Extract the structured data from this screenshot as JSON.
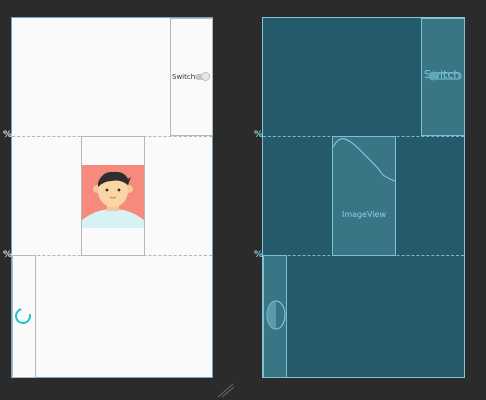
{
  "design": {
    "switch_label": "Switch",
    "image_icon": "avatar-portrait-icon",
    "progress_icon": "progress-spinner-icon"
  },
  "blueprint": {
    "switch_label": "Switch",
    "imageview_label": "ImageView"
  },
  "guides": {
    "percent_symbol": "%"
  },
  "colors": {
    "background": "#2b2b2b",
    "design_surface": "#fafafa",
    "blueprint_surface": "#245a6c",
    "blueprint_line": "#7fc0d0",
    "avatar_bg": "#f58a7d",
    "spinner": "#20c5c7"
  }
}
